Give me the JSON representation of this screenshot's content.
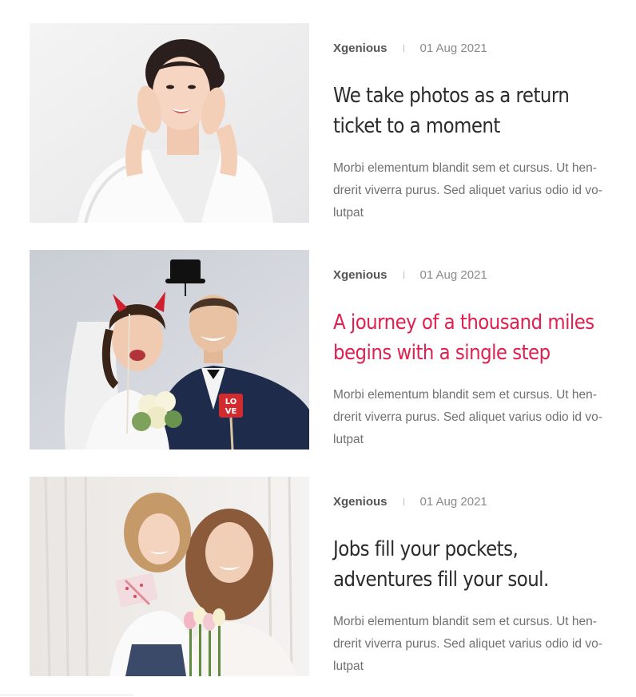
{
  "posts": [
    {
      "image": "portrait-woman-bathrobe-photo",
      "author": "Xgenious",
      "date": "01 Aug 2021",
      "title_lines": [
        "We take photos as a return",
        "ticket to a moment"
      ],
      "excerpt_lines": [
        "Morbi elementum blandit sem et cursus. Ut hen-",
        "drerit viverra purus. Sed aliquet varius odio id vo-",
        "lutpat"
      ],
      "title_color": "#2b2b2b"
    },
    {
      "image": "wedding-couple-photobooth-props-photo",
      "author": "Xgenious",
      "date": "01 Aug 2021",
      "title_lines": [
        "A journey of a thousand miles",
        "begins with a single step"
      ],
      "excerpt_lines": [
        "Morbi elementum blandit sem et cursus. Ut hen-",
        "drerit viverra purus. Sed aliquet varius odio id vo-",
        "lutpat"
      ],
      "title_color": "#e0204f"
    },
    {
      "image": "mother-daughter-tulips-photo",
      "author": "Xgenious",
      "date": "01 Aug 2021",
      "title_lines": [
        "Jobs fill your pockets,",
        "adventures fill your soul."
      ],
      "excerpt_lines": [
        "Morbi elementum blandit sem et cursus. Ut hen-",
        "drerit viverra purus. Sed aliquet varius odio id vo-",
        "lutpat"
      ],
      "title_color": "#2b2b2b"
    }
  ],
  "colors": {
    "accent": "#e0204f",
    "title": "#2b2b2b",
    "author": "#555555",
    "meta": "#8a8a8a",
    "excerpt": "#707070"
  }
}
